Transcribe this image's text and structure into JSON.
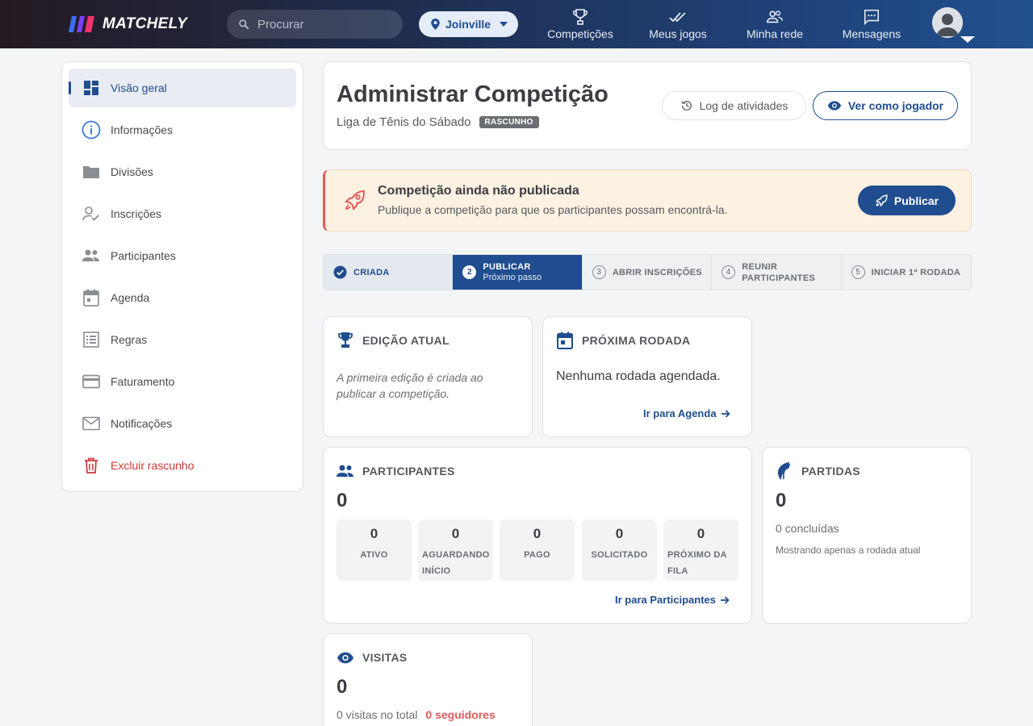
{
  "app": {
    "logo": "MATCHELY"
  },
  "nav": {
    "search_placeholder": "Procurar",
    "city": "Joinville",
    "items": [
      {
        "label": "Competições",
        "icon": "trophy-icon"
      },
      {
        "label": "Meus jogos",
        "icon": "double-check-icon"
      },
      {
        "label": "Minha rede",
        "icon": "people-icon"
      },
      {
        "label": "Mensagens",
        "icon": "chat-icon"
      }
    ]
  },
  "sidebar": {
    "items": [
      {
        "label": "Visão geral",
        "icon": "dashboard-icon",
        "active": true
      },
      {
        "label": "Informações",
        "icon": "info-icon"
      },
      {
        "label": "Divisões",
        "icon": "folder-icon"
      },
      {
        "label": "Inscrições",
        "icon": "user-check-icon"
      },
      {
        "label": "Participantes",
        "icon": "people-icon"
      },
      {
        "label": "Agenda",
        "icon": "calendar-icon"
      },
      {
        "label": "Regras",
        "icon": "list-icon"
      },
      {
        "label": "Faturamento",
        "icon": "credit-card-icon"
      },
      {
        "label": "Notificações",
        "icon": "mail-icon"
      },
      {
        "label": "Excluir rascunho",
        "icon": "trash-icon",
        "danger": true
      }
    ]
  },
  "header": {
    "title": "Administrar Competição",
    "competition_name": "Liga de Tênis do Sábado",
    "status_badge": "RASCUNHO",
    "log_button": "Log de atividades",
    "view_button": "Ver como jogador"
  },
  "alert": {
    "title": "Competição ainda não publicada",
    "text": "Publique a competição para que os participantes possam encontrá-la.",
    "button": "Publicar"
  },
  "stepper": {
    "steps": [
      {
        "label": "CRIADA",
        "state": "done"
      },
      {
        "num": "2",
        "label": "PUBLICAR",
        "sub": "Próximo passo",
        "state": "current"
      },
      {
        "num": "3",
        "label": "ABRIR INSCRIÇÕES",
        "state": "todo"
      },
      {
        "num": "4",
        "label": "REUNIR",
        "label2": "PARTICIPANTES",
        "state": "todo"
      },
      {
        "num": "5",
        "label": "INICIAR 1ª RODADA",
        "state": "todo"
      }
    ]
  },
  "edition": {
    "title": "EDIÇÃO ATUAL",
    "text": "A primeira edição é criada ao publicar a competição."
  },
  "next_round": {
    "title": "PRÓXIMA RODADA",
    "text": "Nenhuma rodada agendada.",
    "link": "Ir para Agenda"
  },
  "participants": {
    "title": "PARTICIPANTES",
    "total": "0",
    "stats": [
      {
        "value": "0",
        "label": "ATIVO"
      },
      {
        "value": "0",
        "label": "AGUARDANDO",
        "label2": "INÍCIO"
      },
      {
        "value": "0",
        "label": "PAGO"
      },
      {
        "value": "0",
        "label": "SOLICITADO"
      },
      {
        "value": "0",
        "label": "PRÓXIMO DA",
        "label2": "FILA"
      }
    ],
    "link": "Ir para Participantes"
  },
  "matches": {
    "title": "PARTIDAS",
    "total": "0",
    "completed": "0 concluídas",
    "note": "Mostrando apenas a rodada atual"
  },
  "visits": {
    "title": "VISITAS",
    "total": "0",
    "visits_text": "0 visitas no total",
    "followers_text": "0 seguidores"
  },
  "colors": {
    "primary": "#1f4d8f",
    "danger": "#d33636",
    "alert_bg": "#fdf1e1",
    "accent_red": "#e45a5a"
  }
}
